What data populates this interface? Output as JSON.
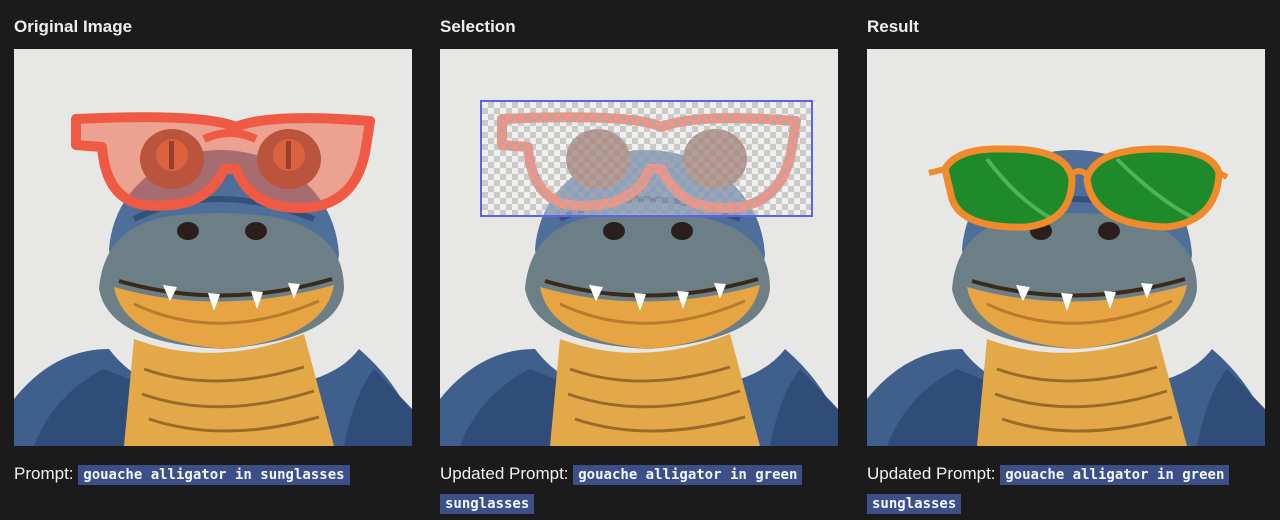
{
  "panels": [
    {
      "title": "Original Image",
      "prompt_label": "Prompt:",
      "prompt_text": "gouache alligator in sunglasses",
      "glasses_color": "#ee5a43"
    },
    {
      "title": "Selection",
      "prompt_label": "Updated Prompt:",
      "prompt_text": "gouache alligator in green sunglasses",
      "selection_color": "#5b63e8"
    },
    {
      "title": "Result",
      "prompt_label": "Updated Prompt:",
      "prompt_text": "gouache alligator in green sunglasses",
      "glasses_color": "#f08a2a",
      "lens_color": "#1f8a2a"
    }
  ],
  "colors": {
    "background": "#1b1b1b",
    "prompt_highlight": "#3c4f86",
    "image_bg": "#e6e6e4"
  }
}
